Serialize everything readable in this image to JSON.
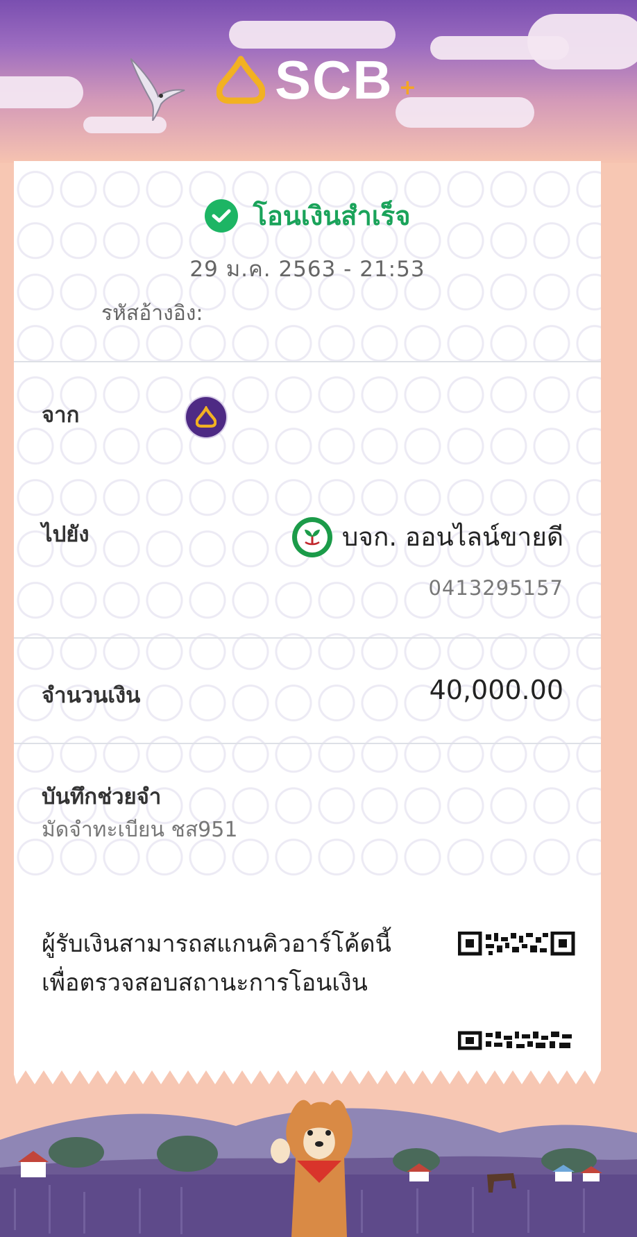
{
  "brand": {
    "name": "SCB",
    "plus": "+"
  },
  "status": {
    "text": "โอนเงินสำเร็จ",
    "color": "#1db564"
  },
  "datetime": "29 ม.ค. 2563 - 21:53",
  "reference": {
    "label": "รหัสอ้างอิง:"
  },
  "from": {
    "label": "จาก",
    "icon": "scb-bank-icon"
  },
  "to": {
    "label": "ไปยัง",
    "name": "บจก. ออนไลน์ขายดี",
    "account": "0413295157",
    "icon": "kbank-icon"
  },
  "amount": {
    "label": "จำนวนเงิน",
    "value": "40,000.00"
  },
  "memo": {
    "label": "บันทึกช่วยจำ",
    "value": "มัดจำทะเบียน ชส951"
  },
  "qr": {
    "line1": "ผู้รับเงินสามารถสแกนคิวอาร์โค้ดนี้",
    "line2": "เพื่อตรวจสอบสถานะการโอนเงิน"
  },
  "colors": {
    "header_top": "#7a4fb0",
    "background": "#f7c7b3",
    "success": "#1db564",
    "scb_purple": "#4e2a84",
    "kbank_green": "#1b9b49"
  }
}
